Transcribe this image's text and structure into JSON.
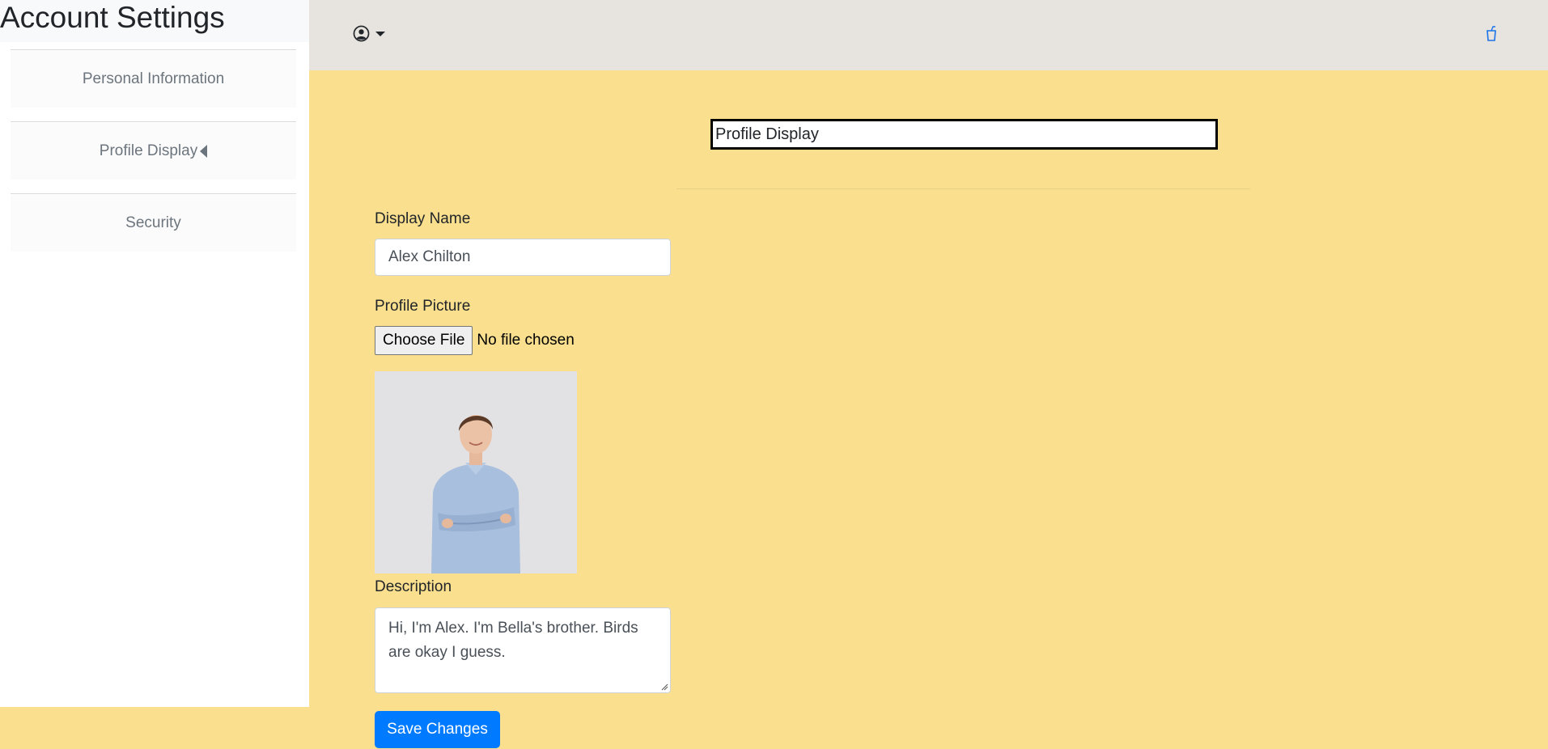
{
  "sidebar": {
    "title": "Account Settings",
    "items": [
      {
        "label": "Personal Information"
      },
      {
        "label": "Profile Display",
        "active": true
      },
      {
        "label": "Security"
      }
    ]
  },
  "topbar": {
    "user_icon": "user-circle-icon",
    "dropdown_icon": "caret-down-icon",
    "right_icon": "cup-icon"
  },
  "main": {
    "section_title": "Profile Display",
    "display_name": {
      "label": "Display Name",
      "value": "Alex Chilton"
    },
    "profile_picture": {
      "label": "Profile Picture",
      "button": "Choose File",
      "status": "No file chosen"
    },
    "description": {
      "label": "Description",
      "value": "Hi, I'm Alex. I'm Bella's brother. Birds are okay I guess."
    },
    "save_label": "Save Changes"
  },
  "colors": {
    "accent": "#007bff",
    "background": "#f9df8e",
    "topbar": "#e7e4df"
  }
}
